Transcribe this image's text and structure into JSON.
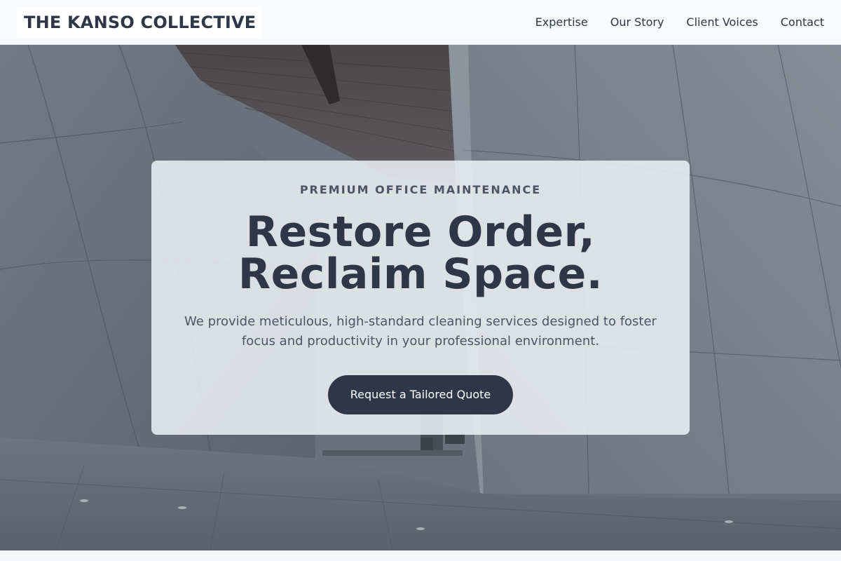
{
  "brand": {
    "name": "THE KANSO COLLECTIVE"
  },
  "nav": {
    "items": [
      {
        "label": "Expertise"
      },
      {
        "label": "Our Story"
      },
      {
        "label": "Client Voices"
      },
      {
        "label": "Contact"
      }
    ]
  },
  "hero": {
    "eyebrow": "PREMIUM OFFICE MAINTENANCE",
    "headline_line1": "Restore Order,",
    "headline_line2": "Reclaim Space.",
    "subtext": "We provide meticulous, high-standard cleaning services designed to foster focus and productivity in your professional environment.",
    "cta_label": "Request a Tailored Quote",
    "background_image": "office-atrium-cleaner-photo"
  },
  "colors": {
    "primary": "#2d3748",
    "muted_text": "#4a5568",
    "nav_bg": "#f8fafc",
    "card_bg": "#eceff3"
  }
}
